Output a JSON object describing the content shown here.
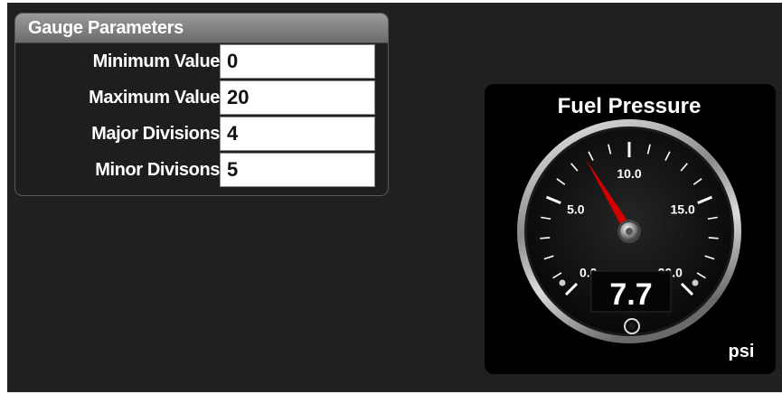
{
  "params": {
    "title": "Gauge Parameters",
    "fields": [
      {
        "label": "Minimum Value",
        "value": "0"
      },
      {
        "label": "Maximum Value",
        "value": "20"
      },
      {
        "label": "Major Divisions",
        "value": "4"
      },
      {
        "label": "Minor Divisons",
        "value": "5"
      }
    ]
  },
  "gauge": {
    "title": "Fuel Pressure",
    "unit": "psi",
    "readout": "7.7",
    "value": 7.7,
    "min": 0,
    "max": 20,
    "major_divisions": 4,
    "minor_divisions": 5,
    "scale_labels": [
      "0.0",
      "5.0",
      "10.0",
      "15.0",
      "20.0"
    ],
    "needle_color": "#d40000",
    "face_color": "#0c0c0c"
  }
}
